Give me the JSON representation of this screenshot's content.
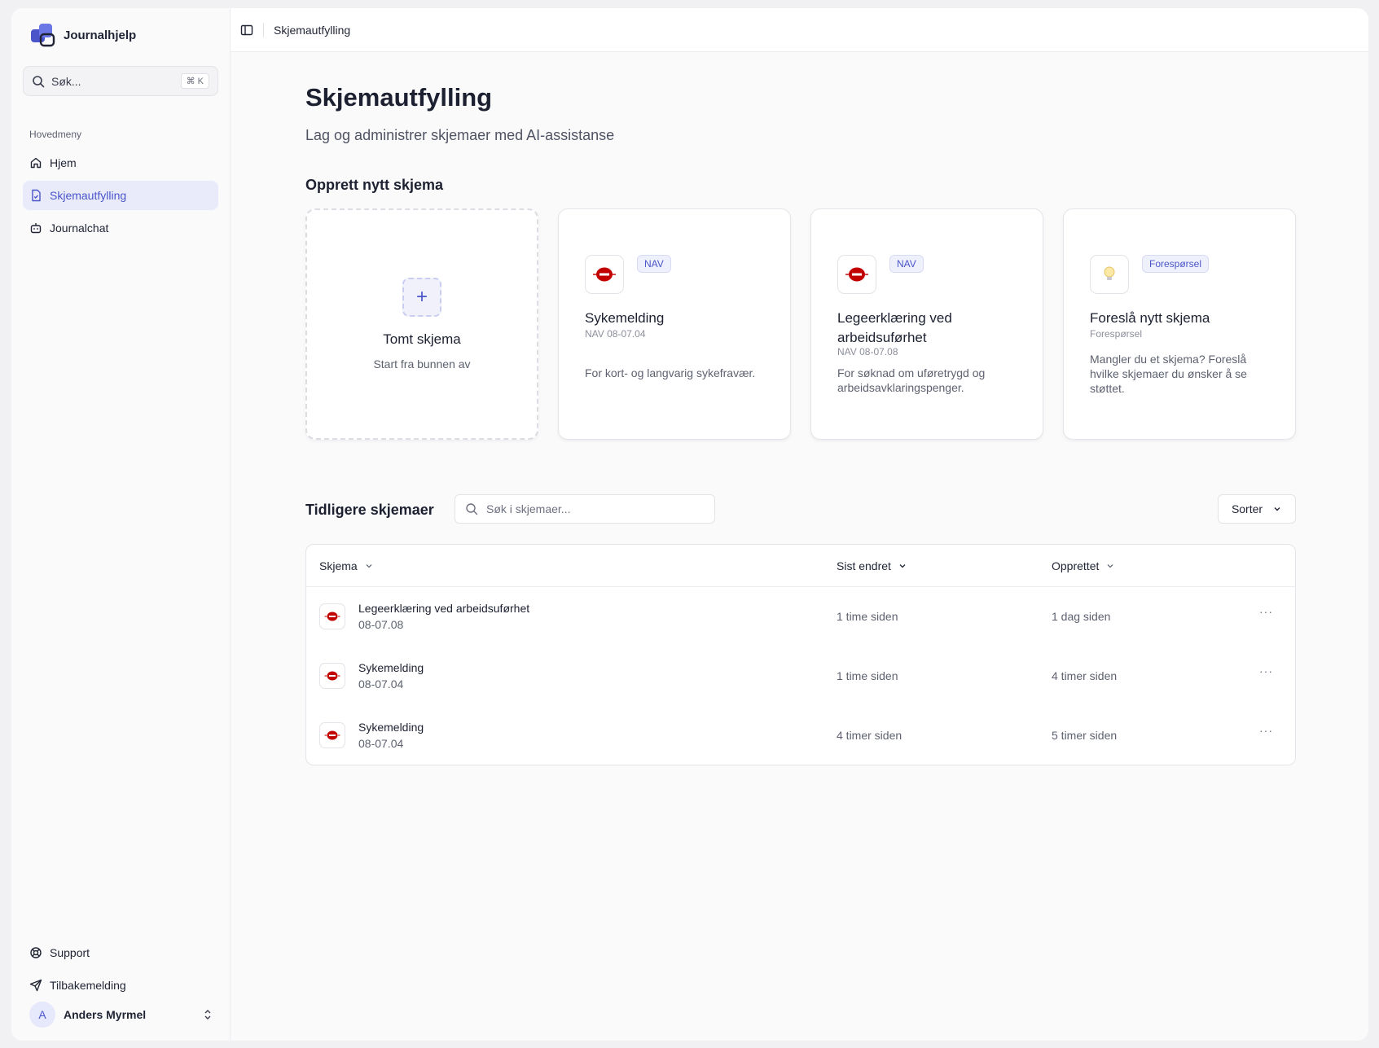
{
  "app": {
    "name": "Journalhjelp"
  },
  "sidebar": {
    "search_placeholder": "Søk...",
    "search_shortcut": "⌘ K",
    "section_label": "Hovedmeny",
    "items": [
      {
        "label": "Hjem",
        "icon": "home-icon",
        "active": false
      },
      {
        "label": "Skjemautfylling",
        "icon": "form-icon",
        "active": true
      },
      {
        "label": "Journalchat",
        "icon": "bot-icon",
        "active": false
      }
    ],
    "bottom_items": [
      {
        "label": "Support",
        "icon": "lifebuoy-icon"
      },
      {
        "label": "Tilbakemelding",
        "icon": "send-icon"
      }
    ],
    "user": {
      "initial": "A",
      "name": "Anders Myrmel"
    }
  },
  "topbar": {
    "breadcrumb": "Skjemautfylling"
  },
  "page": {
    "title": "Skjemautfylling",
    "subtitle": "Lag og administrer skjemaer med AI-assistanse",
    "new_section_title": "Opprett nytt skjema",
    "blank_card": {
      "title": "Tomt skjema",
      "subtitle": "Start fra bunnen av"
    },
    "cards": [
      {
        "badge": "NAV",
        "title": "Sykemelding",
        "code": "NAV 08-07.04",
        "description": "For kort- og langvarig sykefravær.",
        "icon": "nav-logo-icon"
      },
      {
        "badge": "NAV",
        "title": "Legeerklæring ved arbeidsuførhet",
        "code": "NAV 08-07.08",
        "description": "For søknad om uføretrygd og arbeidsavklaringspenger.",
        "icon": "nav-logo-icon"
      },
      {
        "badge": "Forespørsel",
        "title": "Foreslå nytt skjema",
        "code": "Forespørsel",
        "description": "Mangler du et skjema? Foreslå hvilke skjemaer du ønsker å se støttet.",
        "icon": "lightbulb-icon"
      }
    ],
    "previous": {
      "title": "Tidligere skjemaer",
      "search_placeholder": "Søk i skjemaer...",
      "sort_label": "Sorter",
      "columns": [
        "Skjema",
        "Sist endret",
        "Opprettet"
      ],
      "rows": [
        {
          "name": "Legeerklæring ved arbeidsuførhet",
          "code": "08-07.08",
          "modified": "1 time siden",
          "created": "1 dag siden"
        },
        {
          "name": "Sykemelding",
          "code": "08-07.04",
          "modified": "1 time siden",
          "created": "4 timer siden"
        },
        {
          "name": "Sykemelding",
          "code": "08-07.04",
          "modified": "4 timer siden",
          "created": "5 timer siden"
        }
      ]
    }
  },
  "colors": {
    "accent": "#4a55c9",
    "nav_red": "#c30000",
    "active_bg": "#e9ebfb"
  }
}
